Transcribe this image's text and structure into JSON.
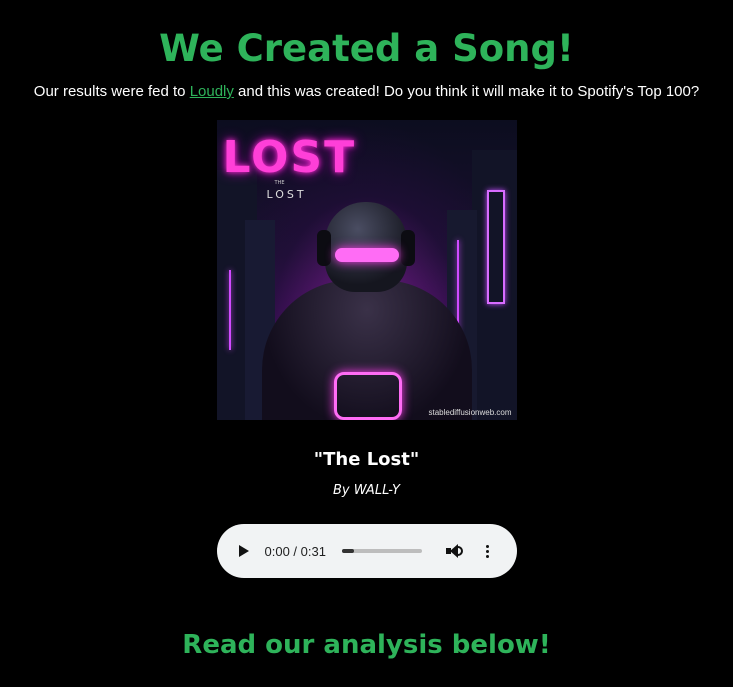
{
  "header": {
    "title": "We Created a Song!",
    "intro_before": "Our results were fed to ",
    "intro_link": "Loudly",
    "intro_after": " and this was created! Do you think it will make it to Spotify's Top 100?"
  },
  "cover": {
    "logo_text": "LOST",
    "subtitle_the": "THE",
    "subtitle": "LOST",
    "watermark": "stablediffusionweb.com"
  },
  "song": {
    "title": "\"The Lost\"",
    "artist": "By WALL-Y"
  },
  "player": {
    "time": "0:00 / 0:31",
    "progress_fraction": 0.0
  },
  "footer": {
    "heading": "Read our analysis below!"
  },
  "colors": {
    "accent": "#2eb35a",
    "background": "#000000",
    "player_bg": "#f1f3f4"
  }
}
